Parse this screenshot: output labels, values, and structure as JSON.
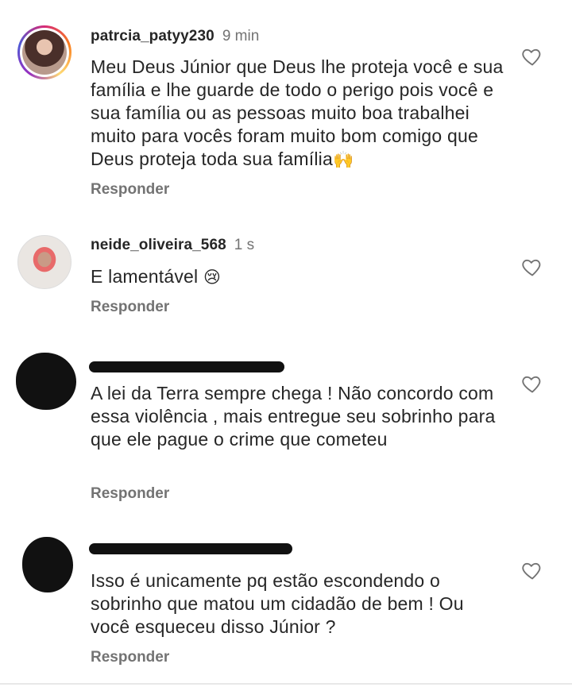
{
  "comments": [
    {
      "username": "patrcia_patyy230",
      "time": "9 min",
      "text": "Meu Deus Júnior que Deus lhe proteja você e sua família e lhe guarde de todo o perigo pois você e sua família ou as pessoas muito boa trabalhei muito para vocês foram muito bom comigo que Deus proteja toda sua família",
      "emoji": "🙌",
      "reply_label": "Responder"
    },
    {
      "username": "neide_oliveira_568",
      "time": "1 s",
      "text": "E lamentável",
      "emoji": "😢",
      "reply_label": "Responder"
    },
    {
      "text": "A lei da Terra sempre chega ! Não concordo com essa violência , mais entregue seu sobrinho para que ele pague o crime que cometeu",
      "reply_label": "Responder"
    },
    {
      "text": "Isso é unicamente pq estão escondendo o sobrinho que matou um cidadão de bem ! Ou você esqueceu disso Júnior ?",
      "reply_label": "Responder"
    }
  ],
  "icons": {
    "like": "heart-icon"
  }
}
